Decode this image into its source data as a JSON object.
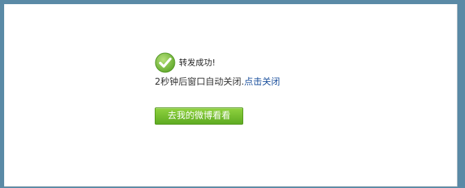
{
  "success": {
    "icon": "checkmark-circle-icon",
    "message": "转发成功!"
  },
  "countdown": {
    "text": "2秒钟后窗口自动关闭.",
    "close_link": "点击关闭"
  },
  "actions": {
    "go_weibo_label": "去我的微博看看"
  },
  "colors": {
    "frame": "#5a8aa6",
    "success_green": "#7cc142",
    "link_blue": "#1a4f9c",
    "button_green": "#6bb52c"
  }
}
